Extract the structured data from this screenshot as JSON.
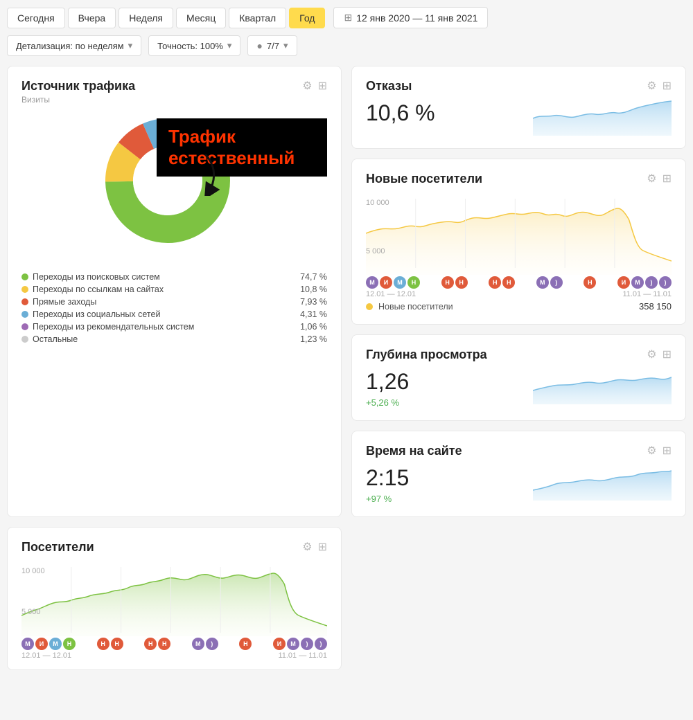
{
  "nav": {
    "buttons": [
      "Сегодня",
      "Вчера",
      "Неделя",
      "Месяц",
      "Квартал",
      "Год"
    ],
    "active": "Год",
    "date_range": "12 янв 2020 — 11 янв 2021"
  },
  "controls": {
    "detail": "Детализация: по неделям",
    "accuracy": "Точность: 100%",
    "segments": "7/7"
  },
  "traffic_source": {
    "title": "Источник трафика",
    "subtitle": "Визиты",
    "gear": "⚙",
    "grid": "⊞",
    "annotation": "Трафик естественный",
    "legend": [
      {
        "label": "Переходы из поисковых систем",
        "value": "74,7 %",
        "color": "#7dc242"
      },
      {
        "label": "Переходы по ссылкам на сайтах",
        "value": "10,8 %",
        "color": "#f5c842"
      },
      {
        "label": "Прямые заходы",
        "value": "7,93 %",
        "color": "#e05a3a"
      },
      {
        "label": "Переходы из социальных сетей",
        "value": "4,31 %",
        "color": "#6baed6"
      },
      {
        "label": "Переходы из рекомендательных систем",
        "value": "1,06 %",
        "color": "#9e6bb5"
      },
      {
        "label": "Остальные",
        "value": "1,23 %",
        "color": "#ccc"
      }
    ],
    "donut": {
      "segments": [
        {
          "percent": 74.7,
          "color": "#7dc242"
        },
        {
          "percent": 10.8,
          "color": "#f5c842"
        },
        {
          "percent": 7.93,
          "color": "#e05a3a"
        },
        {
          "percent": 4.31,
          "color": "#6baed6"
        },
        {
          "percent": 1.06,
          "color": "#9e6bb5"
        },
        {
          "percent": 1.23,
          "color": "#ccc"
        }
      ]
    }
  },
  "bounce_rate": {
    "title": "Отказы",
    "value": "10,6 %"
  },
  "new_visitors": {
    "title": "Новые посетители",
    "label": "Новые посетители",
    "value": "358 150",
    "y_max": "10 000",
    "y_mid": "5 000",
    "date_start": "12.01 — 12.01",
    "date_end": "11.01 — 11.01"
  },
  "depth": {
    "title": "Глубина просмотра",
    "value": "1,26",
    "change": "+5,26 %"
  },
  "time_on_site": {
    "title": "Время на сайте",
    "value": "2:15",
    "change": "+97 %"
  },
  "visitors": {
    "title": "Посетители",
    "y_max": "10 000",
    "y_mid": "5 000",
    "date_start": "12.01 — 12.01",
    "date_end": "11.01 — 11.01"
  },
  "icons": {
    "gear": "⚙",
    "grid": "❑",
    "calendar": "📅",
    "arrow_down": "▾",
    "circle": "●"
  }
}
